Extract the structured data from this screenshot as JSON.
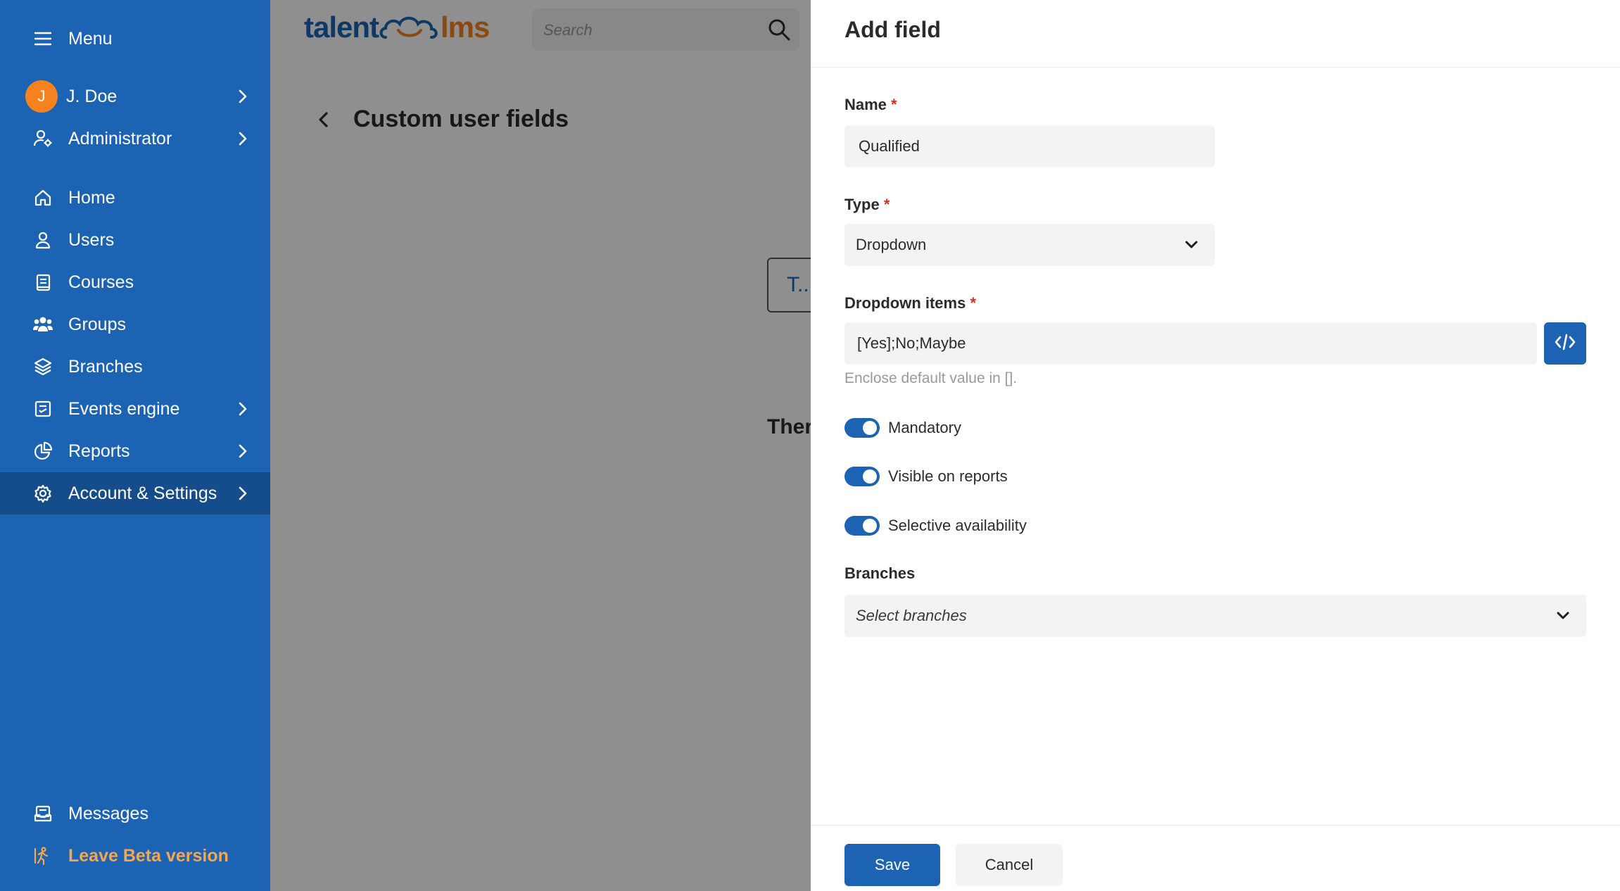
{
  "sidebar": {
    "menu_label": "Menu",
    "user": {
      "initial": "J",
      "name": "J. Doe"
    },
    "role": "Administrator",
    "items": [
      {
        "label": "Home",
        "icon": "home-icon"
      },
      {
        "label": "Users",
        "icon": "user-icon"
      },
      {
        "label": "Courses",
        "icon": "book-icon"
      },
      {
        "label": "Groups",
        "icon": "users-icon"
      },
      {
        "label": "Branches",
        "icon": "layers-icon"
      },
      {
        "label": "Events engine",
        "icon": "calendar-icon"
      },
      {
        "label": "Reports",
        "icon": "pie-chart-icon"
      },
      {
        "label": "Account & Settings",
        "icon": "gear-icon"
      }
    ],
    "messages": "Messages",
    "leave_beta": "Leave Beta version"
  },
  "header": {
    "logo_left": "talent",
    "logo_right": "lms",
    "search_placeholder": "Search"
  },
  "page": {
    "title": "Custom user fields",
    "ghost_box_text": "T..",
    "ghost_text": "Ther"
  },
  "drawer": {
    "title": "Add field",
    "name": {
      "label": "Name",
      "required": "*",
      "value": "Qualified"
    },
    "type": {
      "label": "Type",
      "required": "*",
      "value": "Dropdown"
    },
    "dropdown_items": {
      "label": "Dropdown items",
      "required": "*",
      "value": "[Yes];No;Maybe",
      "hint": "Enclose default value in []."
    },
    "toggles": [
      {
        "label": "Mandatory",
        "on": true
      },
      {
        "label": "Visible on reports",
        "on": true
      },
      {
        "label": "Selective availability",
        "on": true
      }
    ],
    "branches": {
      "label": "Branches",
      "placeholder": "Select branches"
    },
    "save_label": "Save",
    "cancel_label": "Cancel"
  },
  "colors": {
    "primary": "#1c64b3",
    "sidebar_active": "#154d8c",
    "accent_orange": "#f5821f",
    "required_red": "#d93025"
  }
}
